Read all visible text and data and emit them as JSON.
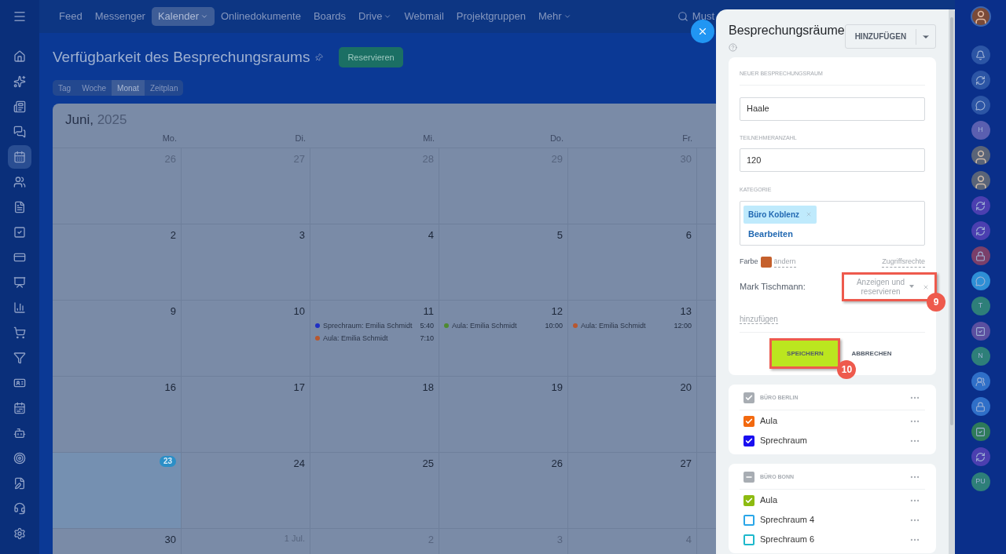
{
  "left_nav": {
    "items": [
      {
        "kind": "home",
        "selected": false
      },
      {
        "kind": "sparkle",
        "selected": false
      },
      {
        "kind": "news",
        "selected": false
      },
      {
        "kind": "chat",
        "selected": false
      },
      {
        "kind": "calendar",
        "selected": true
      },
      {
        "kind": "users",
        "selected": false
      },
      {
        "kind": "file",
        "selected": false
      },
      {
        "kind": "task",
        "selected": false
      },
      {
        "kind": "card",
        "selected": false
      },
      {
        "kind": "board",
        "selected": false
      },
      {
        "kind": "chart",
        "selected": false
      },
      {
        "kind": "cart",
        "selected": false
      },
      {
        "kind": "funnel",
        "selected": false
      },
      {
        "kind": "idcard",
        "selected": false
      },
      {
        "kind": "schedule",
        "selected": false
      },
      {
        "kind": "robot",
        "selected": false
      },
      {
        "kind": "target",
        "selected": false
      },
      {
        "kind": "edit",
        "selected": false
      },
      {
        "kind": "headset",
        "selected": false
      },
      {
        "kind": "settings",
        "selected": false
      }
    ]
  },
  "top_nav": {
    "items": [
      {
        "label": "Feed",
        "selected": false,
        "has_menu": false
      },
      {
        "label": "Messenger",
        "selected": false,
        "has_menu": false
      },
      {
        "label": "Kalender",
        "selected": true,
        "has_menu": true
      },
      {
        "label": "Onlinedokumente",
        "selected": false,
        "has_menu": false
      },
      {
        "label": "Boards",
        "selected": false,
        "has_menu": false
      },
      {
        "label": "Drive",
        "selected": false,
        "has_menu": true
      },
      {
        "label": "Webmail",
        "selected": false,
        "has_menu": false
      },
      {
        "label": "Projektgruppen",
        "selected": false,
        "has_menu": false
      },
      {
        "label": "Mehr",
        "selected": false,
        "has_menu": true
      }
    ],
    "search_text": "Must"
  },
  "page": {
    "title": "Verfügbarkeit des Besprechungsraums",
    "reserve_button": "Reservieren"
  },
  "view_tabs": [
    {
      "label": "Tag",
      "selected": false
    },
    {
      "label": "Woche",
      "selected": false
    },
    {
      "label": "Monat",
      "selected": true
    },
    {
      "label": "Zeitplan",
      "selected": false
    }
  ],
  "calendar": {
    "month": "Juni,",
    "year": "2025",
    "weekdays": [
      "Mo.",
      "Di.",
      "Mi.",
      "Do.",
      "Fr."
    ],
    "weeks": [
      [
        {
          "day": "26",
          "other_month": true,
          "today": false
        },
        {
          "day": "27",
          "other_month": true,
          "today": false
        },
        {
          "day": "28",
          "other_month": true,
          "today": false
        },
        {
          "day": "29",
          "other_month": true,
          "today": false
        },
        {
          "day": "30",
          "other_month": true,
          "today": false
        }
      ],
      [
        {
          "day": "2",
          "other_month": false,
          "today": false
        },
        {
          "day": "3",
          "other_month": false,
          "today": false
        },
        {
          "day": "4",
          "other_month": false,
          "today": false
        },
        {
          "day": "5",
          "other_month": false,
          "today": false
        },
        {
          "day": "6",
          "other_month": false,
          "today": false
        }
      ],
      [
        {
          "day": "9",
          "other_month": false,
          "today": false
        },
        {
          "day": "10",
          "other_month": false,
          "today": false
        },
        {
          "day": "11",
          "other_month": false,
          "today": false,
          "events": [
            {
              "title": "Sprechraum: Emilia Schmidt",
              "time": "5:40",
              "color": "#1f2fc4"
            },
            {
              "title": "Aula: Emilia Schmidt",
              "time": "7:10",
              "color": "#b8572f"
            }
          ]
        },
        {
          "day": "12",
          "other_month": false,
          "today": false,
          "events": [
            {
              "title": "Aula: Emilia Schmidt",
              "time": "10:00",
              "color": "#4e8a30"
            }
          ]
        },
        {
          "day": "13",
          "other_month": false,
          "today": false,
          "events": [
            {
              "title": "Aula: Emilia Schmidt",
              "time": "12:00",
              "color": "#b8572f"
            }
          ]
        }
      ],
      [
        {
          "day": "16",
          "other_month": false,
          "today": false
        },
        {
          "day": "17",
          "other_month": false,
          "today": false
        },
        {
          "day": "18",
          "other_month": false,
          "today": false
        },
        {
          "day": "19",
          "other_month": false,
          "today": false
        },
        {
          "day": "20",
          "other_month": false,
          "today": false
        }
      ],
      [
        {
          "day": "23",
          "other_month": false,
          "today": true
        },
        {
          "day": "24",
          "other_month": false,
          "today": false
        },
        {
          "day": "25",
          "other_month": false,
          "today": false
        },
        {
          "day": "26",
          "other_month": false,
          "today": false
        },
        {
          "day": "27",
          "other_month": false,
          "today": false
        }
      ],
      [
        {
          "day": "30",
          "other_month": false,
          "today": false
        },
        {
          "day": "1 Jul.",
          "other_month": true,
          "today": false
        },
        {
          "day": "2",
          "other_month": true,
          "today": false
        },
        {
          "day": "3",
          "other_month": true,
          "today": false
        },
        {
          "day": "4",
          "other_month": true,
          "today": false
        }
      ]
    ]
  },
  "right_nav": {
    "items": [
      {
        "kind": "bell"
      },
      {
        "kind": "swirl"
      },
      {
        "kind": "chat"
      },
      {
        "kind": "letter",
        "text": "H",
        "color": "#5b5fb0"
      },
      {
        "kind": "person"
      },
      {
        "kind": "person"
      },
      {
        "kind": "swirl",
        "color": "#4b3fb0"
      },
      {
        "kind": "swirl",
        "color": "#4b3fb0"
      },
      {
        "kind": "lock",
        "color": "#7a3f6a"
      },
      {
        "kind": "chat",
        "color": "#2e8fd6"
      },
      {
        "kind": "letter",
        "text": "T",
        "color": "#2e7f79"
      },
      {
        "kind": "board",
        "color": "#5b4fa0"
      },
      {
        "kind": "letter",
        "text": "N",
        "color": "#2e7f79"
      },
      {
        "kind": "people",
        "color": "#2f6fc8"
      },
      {
        "kind": "lock",
        "color": "#2f6fc8"
      },
      {
        "kind": "board",
        "color": "#2e7a5a"
      },
      {
        "kind": "swirl",
        "color": "#4b3fb0"
      },
      {
        "kind": "letter",
        "text": "PU",
        "color": "#2e7f79"
      }
    ]
  },
  "panel": {
    "title": "Besprechungsräume",
    "add_button": "HINZUFÜGEN",
    "form": {
      "section_label": "NEUER BESPRECHUNGSRAUM",
      "name": "Haale",
      "capacity_label": "TEILNEHMERANZAHL",
      "capacity": "120",
      "category_label": "KATEGORIE",
      "category_tag": "Büro Koblenz",
      "edit_link": "Bearbeiten",
      "color_label": "Farbe",
      "color": "#c5602c",
      "change_link": "ändern",
      "access_link": "Zugriffsrechte",
      "access_user": "Mark Tischmann:",
      "access_value": "Anzeigen und reservieren",
      "access_callout": "9",
      "add_link": "hinzufügen",
      "save_button": "SPEICHERN",
      "save_callout": "10",
      "cancel_button": "ABBRECHEN"
    },
    "groups": [
      {
        "name": "BÜRO BERLIN",
        "kind": "all",
        "rooms": [
          {
            "name": "Aula",
            "checked": true,
            "color": "#f2690f"
          },
          {
            "name": "Sprechraum",
            "checked": true,
            "color": "#1a0ff0"
          }
        ]
      },
      {
        "name": "BÜRO BONN",
        "kind": "some",
        "rooms": [
          {
            "name": "Aula",
            "checked": true,
            "color": "#8dbb11"
          },
          {
            "name": "Sprechraum 4",
            "checked": false,
            "color": "#2aa6e8"
          },
          {
            "name": "Sprechraum 6",
            "checked": false,
            "color": "#1eb8cc"
          }
        ]
      }
    ]
  }
}
